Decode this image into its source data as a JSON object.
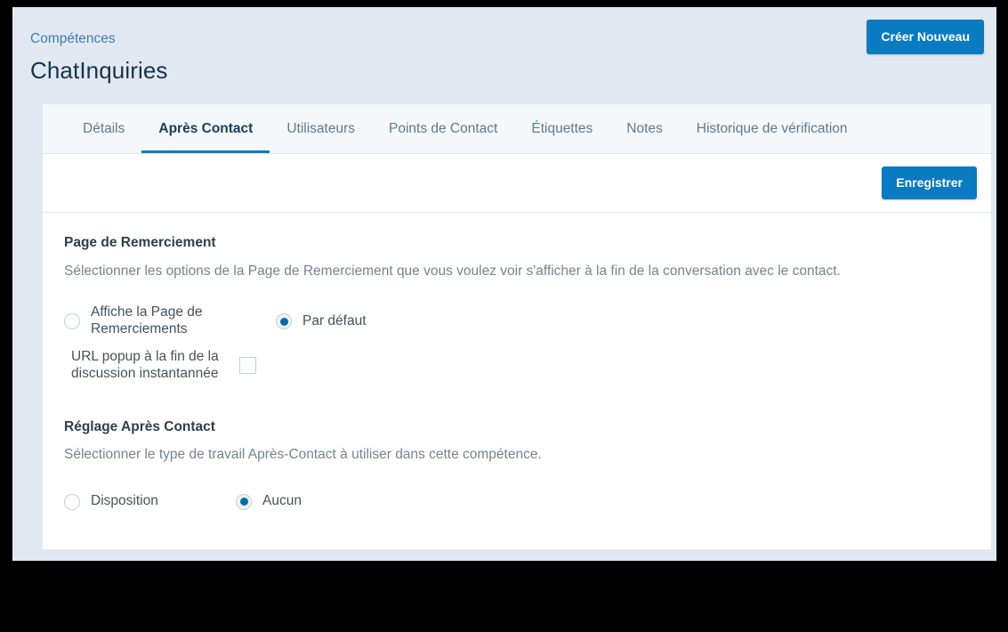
{
  "header": {
    "breadcrumb": "Compétences",
    "title": "ChatInquiries",
    "create_new_label": "Créer Nouveau"
  },
  "tabs": [
    {
      "label": "Détails",
      "active": false
    },
    {
      "label": "Après Contact",
      "active": true
    },
    {
      "label": "Utilisateurs",
      "active": false
    },
    {
      "label": "Points de Contact",
      "active": false
    },
    {
      "label": "Étiquettes",
      "active": false
    },
    {
      "label": "Notes",
      "active": false
    },
    {
      "label": "Historique de vérification",
      "active": false
    }
  ],
  "toolbar": {
    "save_label": "Enregistrer"
  },
  "sections": {
    "thank_you_page": {
      "title": "Page de Remerciement",
      "description": "Sélectionner les options de la Page de Remerciement que vous voulez voir s'afficher à la fin de la conversation avec le contact.",
      "option_show_thank_you_page": "Affiche la Page de Remerciements",
      "option_default": "Par défaut",
      "option_popup_url": "URL popup à la fin de la discussion instantannée"
    },
    "after_contact": {
      "title": "Réglage Après Contact",
      "description": "Sélectionner le type de travail Après-Contact à utiliser dans cette compétence.",
      "option_disposition": "Disposition",
      "option_none": "Aucun"
    }
  },
  "colors": {
    "accent_blue": "#0a7bc1",
    "tab_underline": "#1079ba",
    "breadcrumb_link": "#3e7fb5",
    "app_background": "#e2e8f2",
    "card_background": "#ffffff",
    "radio_selected_dot": "#0a6aa8"
  }
}
